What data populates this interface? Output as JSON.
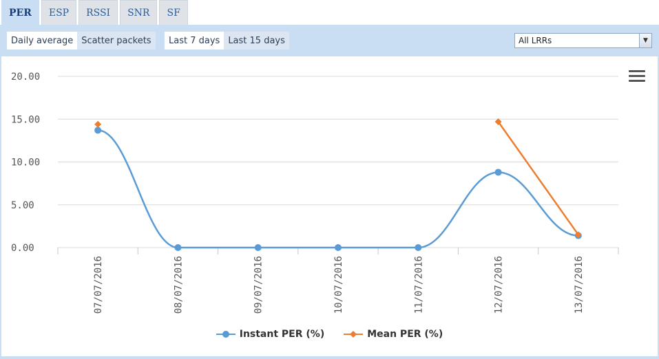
{
  "tabs": [
    {
      "label": "PER",
      "active": true
    },
    {
      "label": "ESP",
      "active": false
    },
    {
      "label": "RSSI",
      "active": false
    },
    {
      "label": "SNR",
      "active": false
    },
    {
      "label": "SF",
      "active": false
    }
  ],
  "toolbar": {
    "mode_buttons": [
      {
        "label": "Daily average",
        "selected": true
      },
      {
        "label": "Scatter packets",
        "selected": false
      }
    ],
    "range_buttons": [
      {
        "label": "Last 7 days",
        "selected": true
      },
      {
        "label": "Last 15 days",
        "selected": false
      }
    ],
    "lrr_select": {
      "value": "All LRRs"
    }
  },
  "colors": {
    "panel": "#c9ddf3",
    "instant": "#5b9bd5",
    "mean": "#ed7d31",
    "grid": "#d8d8d8"
  },
  "icons": {
    "menu": "hamburger-menu-icon"
  },
  "chart_data": {
    "type": "line",
    "x": [
      "07/07/2016",
      "08/07/2016",
      "09/07/2016",
      "10/07/2016",
      "11/07/2016",
      "12/07/2016",
      "13/07/2016"
    ],
    "ylim": [
      0,
      20
    ],
    "yticks": [
      "0.00",
      "5.00",
      "10.00",
      "15.00",
      "20.00"
    ],
    "grid": true,
    "legend_position": "bottom",
    "series": [
      {
        "name": "Instant PER (%)",
        "values": [
          13.7,
          0.0,
          0.0,
          0.0,
          0.0,
          8.8,
          1.4
        ],
        "color": "#5b9bd5",
        "marker": "circle",
        "smooth": true
      },
      {
        "name": "Mean PER (%)",
        "values": [
          14.4,
          null,
          null,
          null,
          null,
          14.7,
          1.5
        ],
        "color": "#ed7d31",
        "marker": "diamond",
        "smooth": false
      }
    ]
  }
}
